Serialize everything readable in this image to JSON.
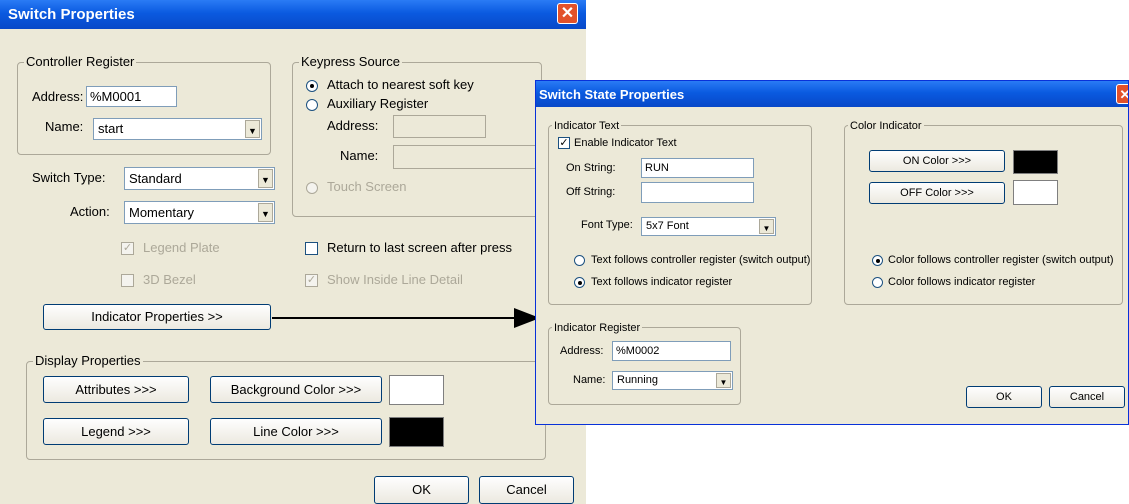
{
  "main": {
    "title": "Switch Properties",
    "close_glyph": "✕",
    "controller_register": {
      "legend": "Controller Register",
      "address_label": "Address:",
      "address_value": "%M0001",
      "name_label": "Name:",
      "name_value": "start"
    },
    "keypress_source": {
      "legend": "Keypress Source",
      "attach_label": "Attach to nearest soft key",
      "aux_label": "Auxiliary Register",
      "address_label": "Address:",
      "address_value": "",
      "name_label": "Name:",
      "name_value": "",
      "touch_label": "Touch Screen"
    },
    "switch_type_label": "Switch Type:",
    "switch_type_value": "Standard",
    "action_label": "Action:",
    "action_value": "Momentary",
    "legend_plate_label": "Legend Plate",
    "bezel_label": "3D Bezel",
    "return_label": "Return to last screen after press",
    "inside_line_label": "Show Inside Line Detail",
    "indicator_properties_button": "Indicator Properties >>",
    "display_properties": {
      "legend": "Display Properties",
      "attributes_button": "Attributes >>>",
      "legend_button": "Legend >>>",
      "background_color_button": "Background Color >>>",
      "line_color_button": "Line Color >>>",
      "background_color": "#ffffff",
      "line_color": "#000000"
    },
    "ok_button": "OK",
    "cancel_button": "Cancel"
  },
  "state": {
    "title": "Switch State Properties",
    "close_glyph": "✕",
    "indicator_text": {
      "legend": "Indicator Text",
      "enable_label": "Enable Indicator Text",
      "on_string_label": "On String:",
      "on_string_value": "RUN",
      "off_string_label": "Off String:",
      "off_string_value": "",
      "font_type_label": "Font Type:",
      "font_type_value": "5x7 Font",
      "follows_controller_label": "Text follows controller register (switch output)",
      "follows_indicator_label": "Text follows indicator register"
    },
    "color_indicator": {
      "legend": "Color Indicator",
      "on_color_button": "ON Color >>>",
      "off_color_button": "OFF Color >>>",
      "on_color": "#000000",
      "off_color": "#ffffff",
      "follows_controller_label": "Color follows controller register (switch output)",
      "follows_indicator_label": "Color follows indicator register"
    },
    "indicator_register": {
      "legend": "Indicator Register",
      "address_label": "Address:",
      "address_value": "%M0002",
      "name_label": "Name:",
      "name_value": "Running"
    },
    "ok_button": "OK",
    "cancel_button": "Cancel"
  }
}
